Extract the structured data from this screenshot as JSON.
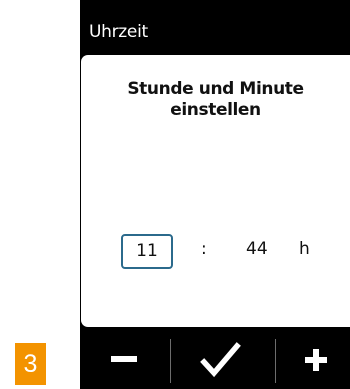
{
  "window": {
    "title": "Uhrzeit"
  },
  "dialog": {
    "instruction": "Stunde und Minute einstellen",
    "hour": "11",
    "separator": ":",
    "minute": "44",
    "unit": "h"
  },
  "buttons": {
    "minus_icon": "minus-icon",
    "confirm_icon": "check-icon",
    "plus_icon": "plus-icon"
  },
  "step_badge": {
    "label": "3",
    "color": "#f39300"
  },
  "colors": {
    "device_background": "#000000",
    "panel_background": "#ffffff",
    "hour_box_border": "#2b6a8c",
    "divider": "#6d6d6d"
  }
}
